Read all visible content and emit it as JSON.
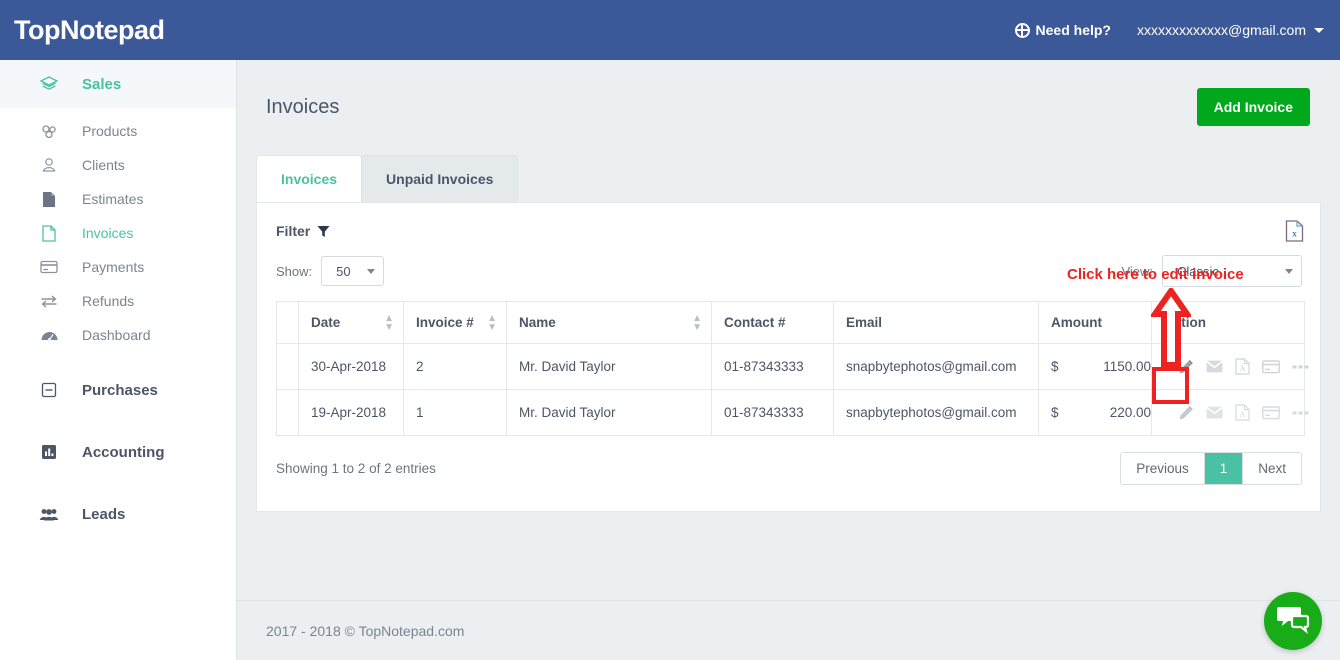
{
  "topbar": {
    "brand": "TopNotepad",
    "brand_prefix": "T",
    "need_help": "Need help?",
    "user_email": "xxxxxxxxxxxxx@gmail.com",
    "help_icon": "life-ring-icon",
    "caret_icon": "caret-down-icon",
    "bg_color": "#3b5998"
  },
  "sidebar": {
    "groups": [
      {
        "label": "Sales",
        "icon": "layers-icon",
        "active": true,
        "items": [
          {
            "label": "Products",
            "icon": "cubes-icon",
            "active": false
          },
          {
            "label": "Clients",
            "icon": "user-icon",
            "active": false
          },
          {
            "label": "Estimates",
            "icon": "file-icon",
            "active": false
          },
          {
            "label": "Invoices",
            "icon": "file-text-icon",
            "active": true
          },
          {
            "label": "Payments",
            "icon": "credit-card-icon",
            "active": false
          },
          {
            "label": "Refunds",
            "icon": "exchange-icon",
            "active": false
          },
          {
            "label": "Dashboard",
            "icon": "gauge-icon",
            "active": false
          }
        ]
      },
      {
        "label": "Purchases",
        "icon": "minus-square-icon",
        "active": false,
        "items": []
      },
      {
        "label": "Accounting",
        "icon": "bar-chart-icon",
        "active": false,
        "items": []
      },
      {
        "label": "Leads",
        "icon": "users-icon",
        "active": false,
        "items": []
      }
    ],
    "accent_color": "#4ac1a5"
  },
  "page": {
    "title": "Invoices",
    "add_button": "Add Invoice",
    "add_button_color": "#00a81c"
  },
  "tabs": [
    {
      "label": "Invoices",
      "active": true
    },
    {
      "label": "Unpaid Invoices",
      "active": false
    }
  ],
  "panel": {
    "filter_label": "Filter",
    "filter_icon": "funnel-icon",
    "export_icon": "excel-export-icon",
    "show_label": "Show:",
    "show_value": "50",
    "view_label": "View:",
    "view_value": "Classic"
  },
  "table": {
    "columns": [
      {
        "label": "",
        "sortable": false
      },
      {
        "label": "Date",
        "sortable": true
      },
      {
        "label": "Invoice #",
        "sortable": true
      },
      {
        "label": "Name",
        "sortable": true
      },
      {
        "label": "Contact #",
        "sortable": false
      },
      {
        "label": "Email",
        "sortable": false
      },
      {
        "label": "Amount",
        "sortable": false
      },
      {
        "label": "Action",
        "sortable": false
      }
    ],
    "rows": [
      {
        "date": "30-Apr-2018",
        "invoice_no": "2",
        "name": "Mr. David Taylor",
        "contact": "01-87343333",
        "email": "snapbytephotos@gmail.com",
        "currency": "$",
        "amount": "1150.00"
      },
      {
        "date": "19-Apr-2018",
        "invoice_no": "1",
        "name": "Mr. David Taylor",
        "contact": "01-87343333",
        "email": "snapbytephotos@gmail.com",
        "currency": "$",
        "amount": "220.00"
      }
    ],
    "action_icons": [
      "edit-pencil-icon",
      "email-envelope-icon",
      "pdf-icon",
      "payment-card-icon",
      "more-options-icon"
    ]
  },
  "pagination": {
    "entries_text": "Showing 1 to 2 of 2 entries",
    "previous": "Previous",
    "current_page": "1",
    "next": "Next",
    "active_color": "#4ac1a5"
  },
  "annotation": {
    "text": "Click here to edit invoice",
    "color": "#ef2222",
    "arrow_icon": "up-arrow-annotation-icon",
    "highlight_icon": "highlight-box-annotation"
  },
  "footer": {
    "copyright": "2017 - 2018 © TopNotepad.com"
  },
  "chat_widget": {
    "icon": "chat-bubbles-icon",
    "color": "#18ad18"
  }
}
